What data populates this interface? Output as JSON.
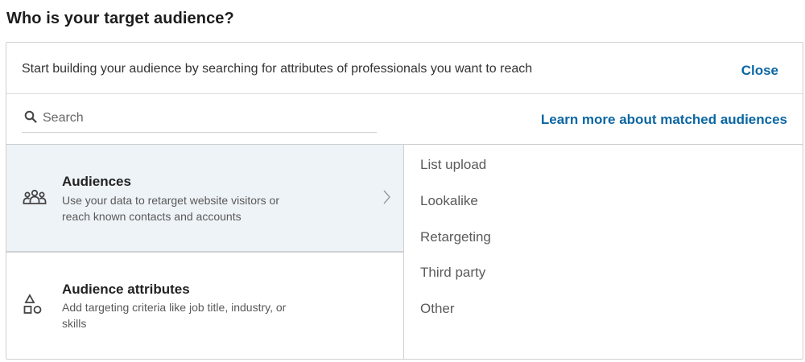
{
  "page": {
    "title": "Who is your target audience?"
  },
  "intro": {
    "text": "Start building your audience by searching for attributes of professionals you want to reach",
    "close_label": "Close"
  },
  "search": {
    "placeholder": "Search",
    "value": "",
    "icon": "search-icon",
    "learn_more_label": "Learn more about matched audiences"
  },
  "categories": [
    {
      "title": "Audiences",
      "description": "Use your data to retarget website visitors or reach known contacts and accounts",
      "icon": "people-group-icon",
      "selected": true
    },
    {
      "title": "Audience attributes",
      "description": "Add targeting criteria like job title, industry, or skills",
      "icon": "shapes-icon",
      "selected": false
    }
  ],
  "options": [
    "List upload",
    "Lookalike",
    "Retargeting",
    "Third party",
    "Other"
  ],
  "colors": {
    "link": "#0a66a2",
    "selected_bg": "#eef3f8",
    "border": "#cfcfcf"
  }
}
